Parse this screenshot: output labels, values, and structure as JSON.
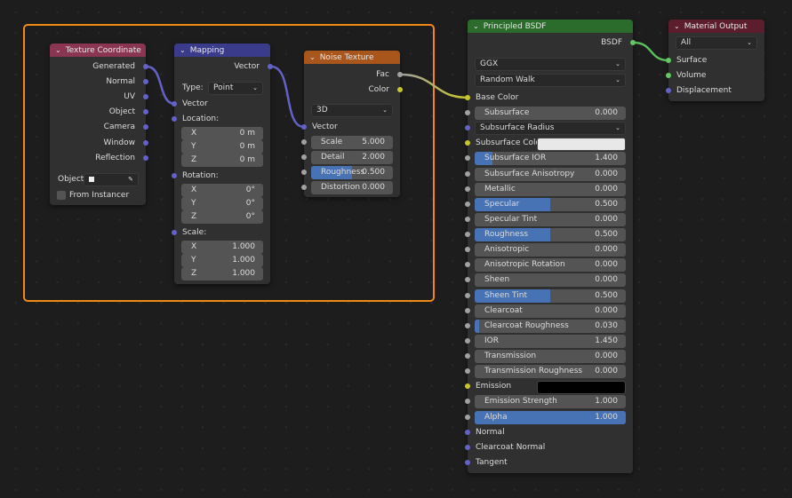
{
  "colors": {
    "frame": "#f08a17",
    "socket_float": "#a1a1a1",
    "socket_vector": "#6363c7",
    "socket_color": "#c7c729",
    "socket_shader": "#63c763",
    "slider_fill": "#4772b3"
  },
  "nodes": {
    "texcoord": {
      "title": "Texture Coordinate",
      "header_color": "#8a3552",
      "rows": [
        {
          "type": "out",
          "label": "Generated",
          "socket": "vector"
        },
        {
          "type": "out",
          "label": "Normal",
          "socket": "vector"
        },
        {
          "type": "out",
          "label": "UV",
          "socket": "vector"
        },
        {
          "type": "out",
          "label": "Object",
          "socket": "vector"
        },
        {
          "type": "out",
          "label": "Camera",
          "socket": "vector"
        },
        {
          "type": "out",
          "label": "Window",
          "socket": "vector"
        },
        {
          "type": "out",
          "label": "Reflection",
          "socket": "vector"
        },
        {
          "type": "objfield",
          "label": "Object:",
          "icon": "eyedropper-icon"
        },
        {
          "type": "check",
          "label": "From Instancer",
          "checked": false
        }
      ]
    },
    "mapping": {
      "title": "Mapping",
      "header_color": "#3b3b8c",
      "rows": [
        {
          "type": "out",
          "label": "Vector",
          "socket": "vector"
        },
        {
          "type": "labeled-select",
          "label": "Type:",
          "value": "Point"
        },
        {
          "type": "in",
          "label": "Vector",
          "socket": "vector"
        },
        {
          "type": "in",
          "label": "Location:",
          "socket": "vector"
        },
        {
          "type": "field",
          "label": "X",
          "value": "0 m",
          "axis": true
        },
        {
          "type": "field",
          "label": "Y",
          "value": "0 m",
          "axis": true
        },
        {
          "type": "field",
          "label": "Z",
          "value": "0 m",
          "axis": true
        },
        {
          "type": "in",
          "label": "Rotation:",
          "socket": "vector"
        },
        {
          "type": "field",
          "label": "X",
          "value": "0°",
          "axis": true
        },
        {
          "type": "field",
          "label": "Y",
          "value": "0°",
          "axis": true
        },
        {
          "type": "field",
          "label": "Z",
          "value": "0°",
          "axis": true
        },
        {
          "type": "in",
          "label": "Scale:",
          "socket": "vector"
        },
        {
          "type": "field",
          "label": "X",
          "value": "1.000",
          "axis": true
        },
        {
          "type": "field",
          "label": "Y",
          "value": "1.000",
          "axis": true
        },
        {
          "type": "field",
          "label": "Z",
          "value": "1.000",
          "axis": true
        }
      ]
    },
    "noise": {
      "title": "Noise Texture",
      "header_color": "#a8561c",
      "rows": [
        {
          "type": "out",
          "label": "Fac",
          "socket": "float"
        },
        {
          "type": "out",
          "label": "Color",
          "socket": "color"
        },
        {
          "type": "select",
          "value": "3D"
        },
        {
          "type": "in",
          "label": "Vector",
          "socket": "vector"
        },
        {
          "type": "field",
          "label": "Scale",
          "value": "5.000",
          "socket": "float"
        },
        {
          "type": "field",
          "label": "Detail",
          "value": "2.000",
          "socket": "float"
        },
        {
          "type": "field",
          "label": "Roughness",
          "value": "0.500",
          "socket": "float",
          "fill": 0.5
        },
        {
          "type": "field",
          "label": "Distortion",
          "value": "0.000",
          "socket": "float"
        }
      ]
    },
    "bsdf": {
      "title": "Principled BSDF",
      "header_color": "#2b6b2b",
      "rows": [
        {
          "type": "out",
          "label": "BSDF",
          "socket": "shader"
        },
        {
          "type": "select",
          "value": "GGX"
        },
        {
          "type": "select",
          "value": "Random Walk"
        },
        {
          "type": "in",
          "label": "Base Color",
          "socket": "color"
        },
        {
          "type": "field",
          "label": "Subsurface",
          "value": "0.000",
          "socket": "float"
        },
        {
          "type": "select",
          "value": "Subsurface Radius",
          "socket": "vector"
        },
        {
          "type": "colorin",
          "label": "Subsurface Colo",
          "socket": "color",
          "swatch": "#e8e8e8"
        },
        {
          "type": "field",
          "label": "Subsurface IOR",
          "value": "1.400",
          "socket": "float",
          "fill": 0.12
        },
        {
          "type": "field",
          "label": "Subsurface Anisotropy",
          "value": "0.000",
          "socket": "float"
        },
        {
          "type": "field",
          "label": "Metallic",
          "value": "0.000",
          "socket": "float"
        },
        {
          "type": "field",
          "label": "Specular",
          "value": "0.500",
          "socket": "float",
          "fill": 0.5
        },
        {
          "type": "field",
          "label": "Specular Tint",
          "value": "0.000",
          "socket": "float"
        },
        {
          "type": "field",
          "label": "Roughness",
          "value": "0.500",
          "socket": "float",
          "fill": 0.5
        },
        {
          "type": "field",
          "label": "Anisotropic",
          "value": "0.000",
          "socket": "float"
        },
        {
          "type": "field",
          "label": "Anisotropic Rotation",
          "value": "0.000",
          "socket": "float"
        },
        {
          "type": "field",
          "label": "Sheen",
          "value": "0.000",
          "socket": "float"
        },
        {
          "type": "field",
          "label": "Sheen Tint",
          "value": "0.500",
          "socket": "float",
          "fill": 0.5
        },
        {
          "type": "field",
          "label": "Clearcoat",
          "value": "0.000",
          "socket": "float"
        },
        {
          "type": "field",
          "label": "Clearcoat Roughness",
          "value": "0.030",
          "socket": "float",
          "fill": 0.03
        },
        {
          "type": "field",
          "label": "IOR",
          "value": "1.450",
          "socket": "float"
        },
        {
          "type": "field",
          "label": "Transmission",
          "value": "0.000",
          "socket": "float"
        },
        {
          "type": "field",
          "label": "Transmission Roughness",
          "value": "0.000",
          "socket": "float"
        },
        {
          "type": "colorin",
          "label": "Emission",
          "socket": "color",
          "swatch": "#000000"
        },
        {
          "type": "field",
          "label": "Emission Strength",
          "value": "1.000",
          "socket": "float"
        },
        {
          "type": "field",
          "label": "Alpha",
          "value": "1.000",
          "socket": "float",
          "fill": 1.0
        },
        {
          "type": "in",
          "label": "Normal",
          "socket": "vector"
        },
        {
          "type": "in",
          "label": "Clearcoat Normal",
          "socket": "vector"
        },
        {
          "type": "in",
          "label": "Tangent",
          "socket": "vector"
        }
      ]
    },
    "output": {
      "title": "Material Output",
      "header_color": "#5c1e2c",
      "rows": [
        {
          "type": "select",
          "value": "All"
        },
        {
          "type": "in",
          "label": "Surface",
          "socket": "shader"
        },
        {
          "type": "in",
          "label": "Volume",
          "socket": "shader"
        },
        {
          "type": "in",
          "label": "Displacement",
          "socket": "vector"
        }
      ]
    }
  }
}
